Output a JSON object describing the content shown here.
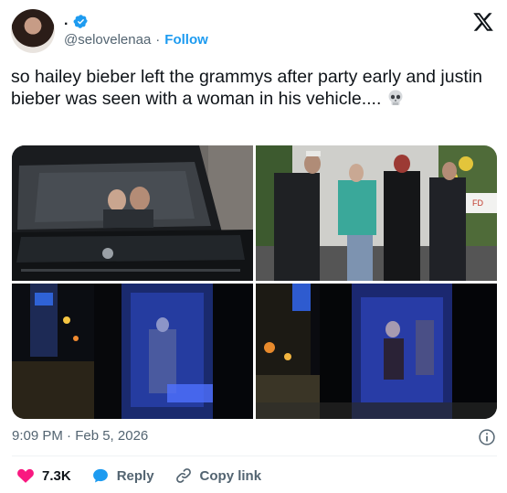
{
  "author": {
    "display_name": ".",
    "handle": "@selovelenaa",
    "separator": "·",
    "follow_label": "Follow",
    "verified_color": "#1d9bf0"
  },
  "tweet": {
    "text": "so hailey bieber left the grammys after party early and justin bieber was seen with a woman in his vehicle....",
    "emoji": "skull-emoji",
    "media_count": 4
  },
  "meta": {
    "timestamp": "9:09 PM · Feb 5, 2026"
  },
  "actions": {
    "like_count": "7.3K",
    "reply_label": "Reply",
    "copy_link_label": "Copy link"
  },
  "colors": {
    "like": "#f91880",
    "reply": "#1d9bf0",
    "muted": "#536471",
    "text": "#0f1419"
  }
}
